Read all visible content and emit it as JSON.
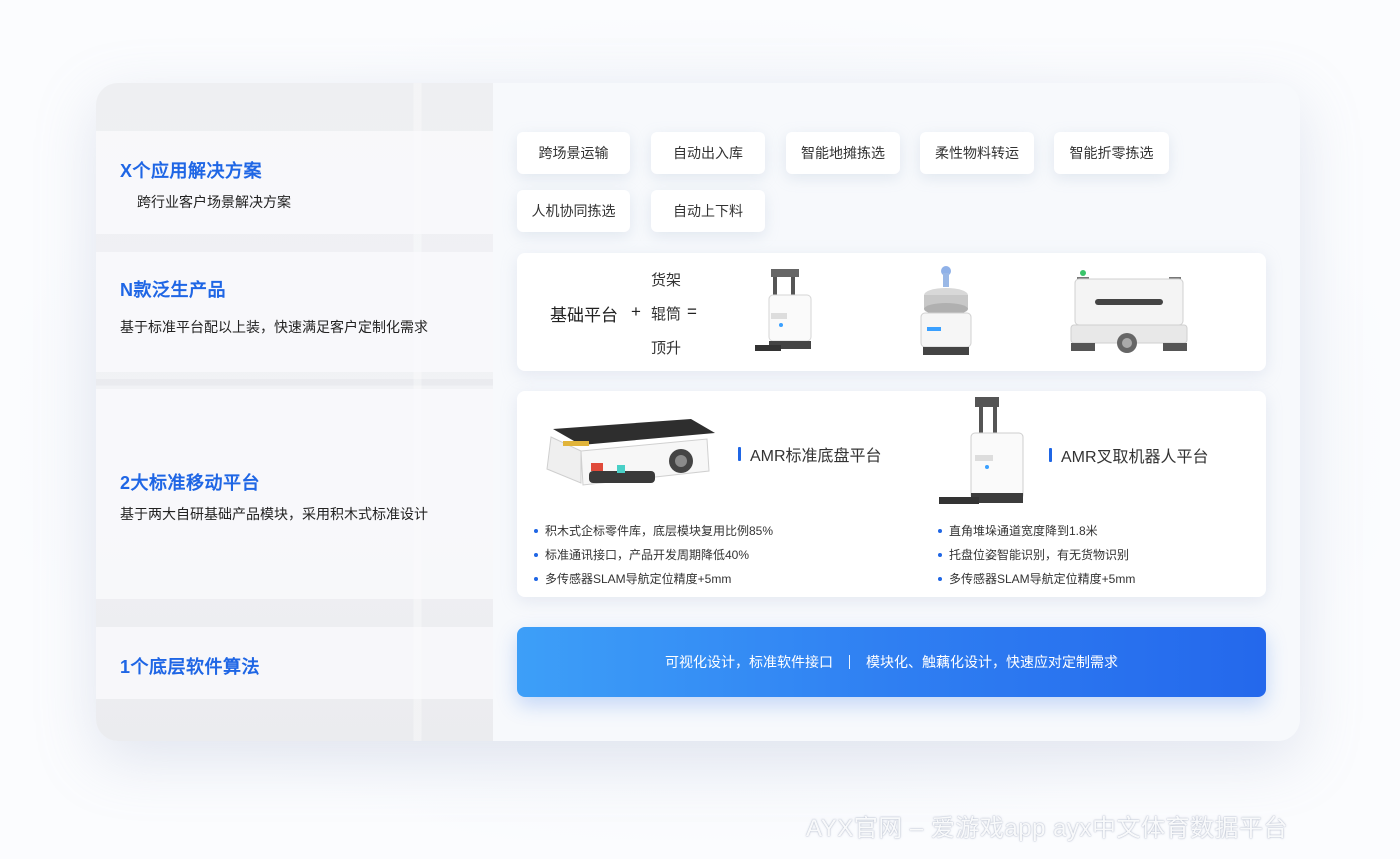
{
  "left_sections": [
    {
      "title": "X个应用解决方案",
      "desc": "跨行业客户场景解决方案"
    },
    {
      "title": "N款泛生产品",
      "desc": "基于标准平台配以上装，快速满足客户定制化需求"
    },
    {
      "title": "2大标准移动平台",
      "desc": "基于两大自研基础产品模块，采用积木式标准设计"
    },
    {
      "title": "1个底层软件算法",
      "desc": ""
    }
  ],
  "chips": [
    "跨场景运输",
    "自动出入库",
    "智能地摊拣选",
    "柔性物料转运",
    "智能折零拣选",
    "人机协同拣选",
    "自动上下料"
  ],
  "formula": {
    "base": "基础平台",
    "plus": "+",
    "options": [
      "货架",
      "辊筒",
      "顶升"
    ],
    "equals": "="
  },
  "platforms": [
    {
      "title": "AMR标准底盘平台",
      "bullets": [
        "积木式企标零件库，底层模块复用比例85%",
        "标准通讯接口，产品开发周期降低40%",
        "多传感器SLAM导航定位精度+5mm"
      ]
    },
    {
      "title": "AMR叉取机器人平台",
      "bullets": [
        "直角堆垛通道宽度降到1.8米",
        "托盘位姿智能识别，有无货物识别",
        "多传感器SLAM导航定位精度+5mm"
      ]
    }
  ],
  "banner": {
    "left": "可视化设计，标准软件接口",
    "right": "模块化、触藕化设计，快速应对定制需求"
  },
  "watermark": "AYX官网 – 爱游戏app ayx中文体育数据平台",
  "colors": {
    "accent": "#1f66e5",
    "banner_start": "#3d9ff8",
    "banner_end": "#2468ec"
  }
}
